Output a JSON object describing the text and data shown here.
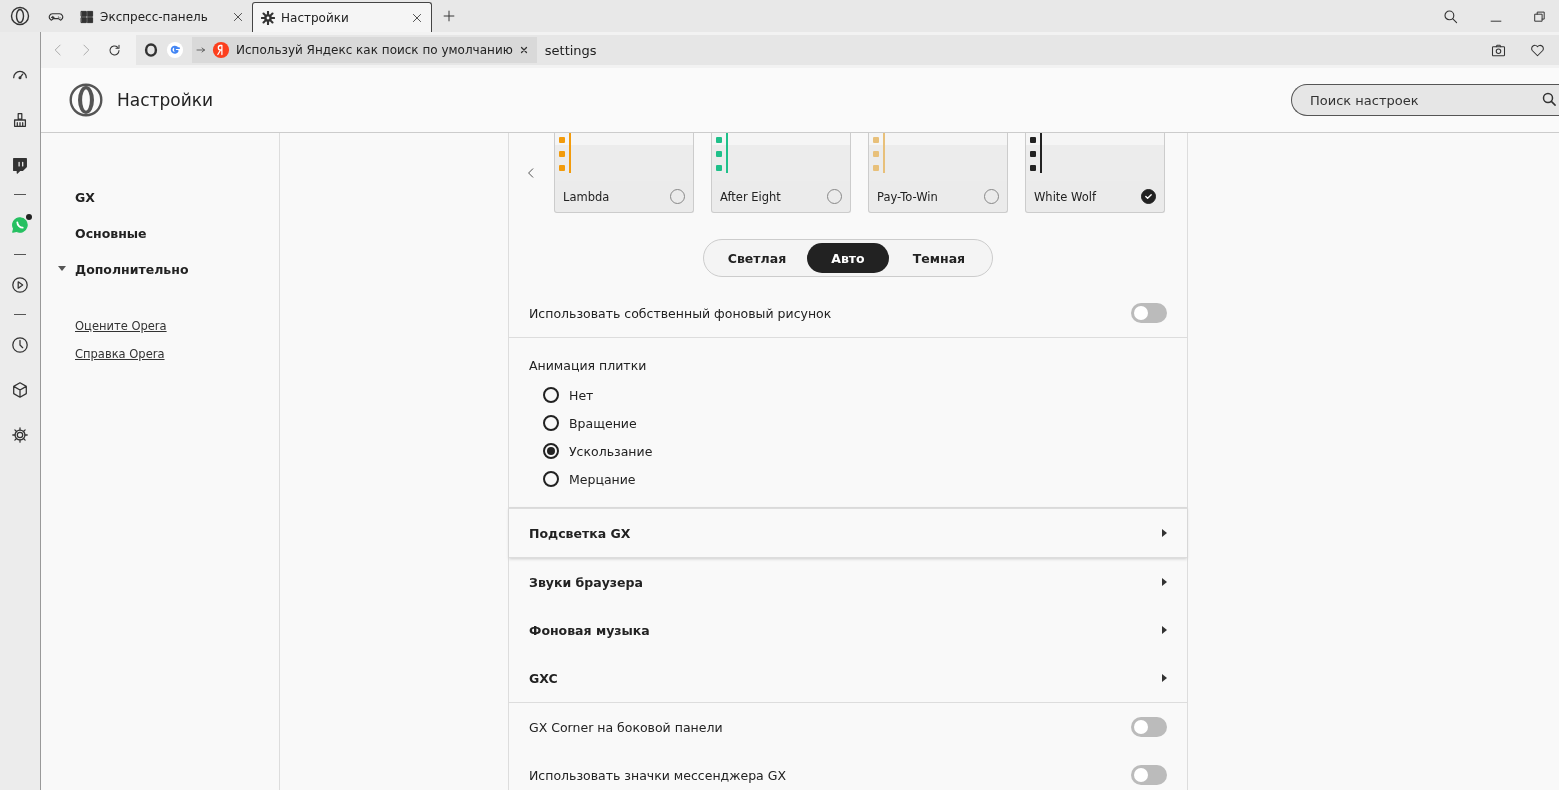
{
  "tabs": [
    {
      "kind": "game",
      "selected": false
    },
    {
      "kind": "speed_dial",
      "title": "Экспресс-панель",
      "selected": false
    },
    {
      "kind": "settings",
      "title": "Настройки",
      "selected": true
    }
  ],
  "address_bar": {
    "promo": "Используй Яндекс как поиск по умолчанию",
    "url": "settings"
  },
  "sidebar": [
    {
      "kind": "speedometer"
    },
    {
      "kind": "broom"
    },
    {
      "kind": "twitch"
    },
    {
      "kind": "divider"
    },
    {
      "kind": "whatsapp",
      "notification": true
    },
    {
      "kind": "divider"
    },
    {
      "kind": "player"
    },
    {
      "kind": "divider"
    },
    {
      "kind": "history"
    },
    {
      "kind": "cube"
    },
    {
      "kind": "settings"
    }
  ],
  "header": {
    "title": "Настройки",
    "search": {
      "placeholder": "Поиск настроек"
    }
  },
  "nav": {
    "items": [
      {
        "label": "GX"
      },
      {
        "label": "Основные"
      },
      {
        "label": "Дополнительно",
        "expanded": true
      }
    ],
    "links": [
      "Оцените Opera",
      "Справка Opera"
    ]
  },
  "themes": [
    {
      "name": "Lambda",
      "color": "#f29b0c",
      "selected": false
    },
    {
      "name": "After Eight",
      "color": "#1fc08a",
      "selected": false
    },
    {
      "name": "Pay-To-Win",
      "color": "#e8c07a",
      "selected": false
    },
    {
      "name": "White Wolf",
      "color": "#222222",
      "selected": true
    }
  ],
  "mode_switch": [
    {
      "label": "Светлая",
      "selected": false
    },
    {
      "label": "Авто",
      "selected": true
    },
    {
      "label": "Темная",
      "selected": false
    }
  ],
  "sections": [
    {
      "rows": [
        {
          "kind": "toggle",
          "label": "Использовать собственный фоновый рисунок",
          "on": false
        }
      ]
    },
    {
      "rows": [
        {
          "kind": "radio_group",
          "label": "Анимация плитки",
          "options": [
            {
              "label": "Нет",
              "selected": false
            },
            {
              "label": "Вращение",
              "selected": false
            },
            {
              "label": "Ускользание",
              "selected": true
            },
            {
              "label": "Мерцание",
              "selected": false
            }
          ]
        }
      ]
    },
    {
      "rows": [
        {
          "kind": "submenu",
          "label": "Подсветка GX"
        }
      ]
    },
    {
      "rows": [
        {
          "kind": "submenu",
          "label": "Звуки браузера"
        },
        {
          "kind": "submenu",
          "label": "Фоновая музыка"
        },
        {
          "kind": "submenu",
          "label": "GXC"
        }
      ]
    },
    {
      "rows": [
        {
          "kind": "toggle",
          "label": "GX Corner на боковой панели",
          "on": false
        },
        {
          "kind": "toggle",
          "label": "Использовать значки мессенджера GX",
          "on": false
        }
      ]
    }
  ]
}
